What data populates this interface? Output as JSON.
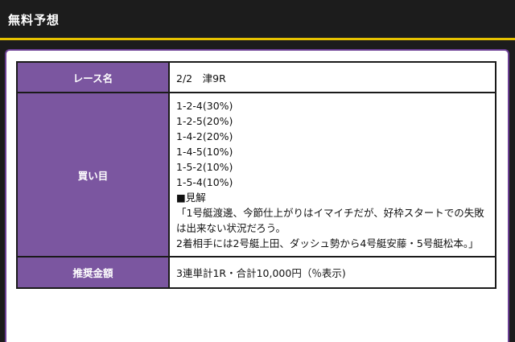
{
  "header": {
    "title": "無料予想"
  },
  "colors": {
    "header_bg": "#1c1c1c",
    "accent_yellow": "#e6c200",
    "label_purple": "#7b56a0",
    "panel_border_purple": "#6b3f94"
  },
  "table": {
    "race_label": "レース名",
    "race_value": "2/2　津9R",
    "bets_label": "買い目",
    "bets": [
      "1-2-4(30%)",
      "1-2-5(20%)",
      "1-4-2(20%)",
      "1-4-5(10%)",
      "1-5-2(10%)",
      "1-5-4(10%)"
    ],
    "comment_heading": "■見解",
    "comment_lines": [
      "「1号艇渡邊、今節仕上がりはイマイチだが、好枠スタートでの失敗",
      "は出来ない状況だろう。",
      "2着相手には2号艇上田、ダッシュ勢から4号艇安藤・5号艇松本。」"
    ],
    "amount_label": "推奨金額",
    "amount_value": "3連単計1R・合計10,000円（％表示)"
  }
}
